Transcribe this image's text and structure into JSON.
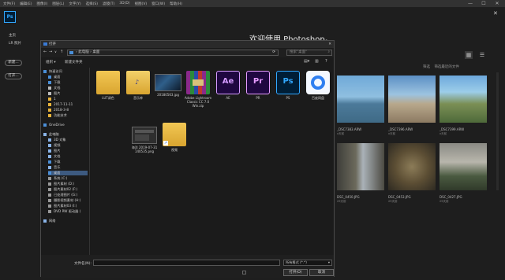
{
  "app": {
    "logo": "Ps",
    "menu": [
      "文件(F)",
      "编辑(E)",
      "图像(I)",
      "图层(L)",
      "文字(Y)",
      "选择(S)",
      "滤镜(T)",
      "3D(D)",
      "视图(V)",
      "窗口(W)",
      "帮助(H)"
    ],
    "window_controls": [
      "—",
      "☐",
      "✕"
    ],
    "side_links": [
      "主页",
      "LR 照片"
    ],
    "side_buttons": [
      "新建...",
      "打开..."
    ],
    "welcome": "欢迎使用 Photoshop。",
    "close_x": "✕",
    "filter_label": "筛选",
    "filter_placeholder": "筛选最近的文件",
    "recent": [
      {
        "name": "_DSC7383.ARW",
        "sub": "x天前"
      },
      {
        "name": "_DSC7396.ARW",
        "sub": "x天前"
      },
      {
        "name": "_DSC7399.ARW",
        "sub": "x天前"
      },
      {
        "name": "DSC_0450.JPG",
        "sub": "29天前"
      },
      {
        "name": "DSC_0453.JPG",
        "sub": "29天前"
      },
      {
        "name": "DSC_0427.JPG",
        "sub": "29天前"
      }
    ]
  },
  "dialog": {
    "title": "打开",
    "nav": [
      "←",
      "→",
      "∨",
      "↑"
    ],
    "address": "› 此电脑 › 桌面",
    "search_placeholder": "搜索\"桌面\"",
    "toolbar": {
      "organize": "组织 ▾",
      "new_folder": "新建文件夹"
    },
    "nav_items": [
      {
        "label": "快速访问",
        "color": "#4a8fd8"
      },
      {
        "label": "桌面",
        "color": "#4a8fd8"
      },
      {
        "label": "下载",
        "color": "#4a8fd8"
      },
      {
        "label": "文档",
        "color": "#bbb"
      },
      {
        "label": "图片",
        "color": "#bbb"
      },
      {
        "label": "1",
        "color": "#e8b33b"
      },
      {
        "label": "2017-11-11",
        "color": "#e8b33b"
      },
      {
        "label": "2018-3-8",
        "color": "#e8b33b"
      },
      {
        "label": "功能技术",
        "color": "#e8b33b"
      },
      {
        "label": "OneDrive",
        "color": "#4a8fd8"
      },
      {
        "label": "此电脑",
        "color": "#8ab4e8"
      },
      {
        "label": "3D 对象",
        "color": "#8ab4e8"
      },
      {
        "label": "视频",
        "color": "#8ab4e8"
      },
      {
        "label": "图片",
        "color": "#8ab4e8"
      },
      {
        "label": "文档",
        "color": "#8ab4e8"
      },
      {
        "label": "下载",
        "color": "#4a8fd8"
      },
      {
        "label": "音乐",
        "color": "#8ab4e8"
      },
      {
        "label": "桌面",
        "color": "#4a8fd8"
      },
      {
        "label": "系统 (C:)",
        "color": "#999"
      },
      {
        "label": "图片素材 (D:)",
        "color": "#999"
      },
      {
        "label": "图片素材02 (F:)",
        "color": "#999"
      },
      {
        "label": "已处理图片 (G:)",
        "color": "#999"
      },
      {
        "label": "摄影视频素材 (H:)",
        "color": "#999"
      },
      {
        "label": "图片素材03 (I:)",
        "color": "#999"
      },
      {
        "label": "DVD RW 驱动器 (",
        "color": "#999"
      },
      {
        "label": "网络",
        "color": "#8ab4e8"
      }
    ],
    "files": [
      {
        "name": "LUT调色",
        "type": "folder"
      },
      {
        "name": "音乐库",
        "type": "folder"
      },
      {
        "name": "20180563.jpg",
        "type": "image"
      },
      {
        "name": "Adobe Lightroom Classic CC 7.0 Win.zip",
        "type": "zip"
      },
      {
        "name": "AE",
        "type": "app",
        "tile": "Ae",
        "bg": "#1f0740",
        "fg": "#d59bff"
      },
      {
        "name": "PR",
        "type": "app",
        "tile": "Pr",
        "bg": "#1f0740",
        "fg": "#e59bff"
      },
      {
        "name": "PS",
        "type": "app",
        "tile": "Ps",
        "bg": "#001e36",
        "fg": "#31a8ff"
      },
      {
        "name": "百度网盘",
        "type": "baidu"
      },
      {
        "name": "海洋 2019-07-31 140535.png",
        "type": "image2"
      },
      {
        "name": "视频",
        "type": "folder-shortcut"
      }
    ],
    "filename_label": "文件名(N):",
    "format": "所有格式 (*.*)",
    "open_btn": "打开(O)",
    "cancel_btn": "取消"
  }
}
